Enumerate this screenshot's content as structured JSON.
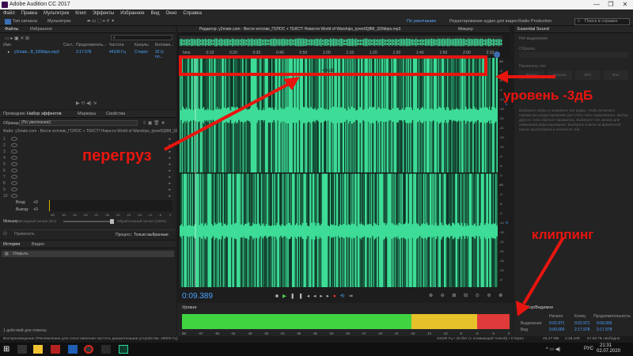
{
  "window": {
    "title": "Adobe Audition CC 2017",
    "controls": [
      "—",
      "❐",
      "✕"
    ]
  },
  "menu": [
    "Файл",
    "Правка",
    "Мультитрек",
    "Клип",
    "Эффекты",
    "Избранное",
    "Вид",
    "Окно",
    "Справка"
  ],
  "toolbar": {
    "waveform_label": "Тип сигнала",
    "multitrack_label": "Мультитрек",
    "workspace_default": "По умолчанию",
    "workspace_edit_audio": "Редактирование аудио для видео",
    "workspace_radio": "Radio Production",
    "search_placeholder": "Поиск в справке"
  },
  "files_panel": {
    "tabs": [
      "Файлы",
      "Избранное"
    ],
    "columns": [
      "Имя",
      "Сост...",
      "Продолжитель...",
      "Частота",
      "Каналы",
      "Битовая..."
    ],
    "file": {
      "name": "y2mate.com - Вест...ЛОС_+_ТЕКСТ!_Новост...B_320kbps.mp3",
      "name_short": "y2mate...B_320kbps.mp3",
      "duration": "2:17.978",
      "rate": "44100 Гц",
      "channels": "Стерео",
      "bits": "32 (с пл..."
    }
  },
  "effects_panel": {
    "tabs": [
      "Проводник",
      "Набор эффектов",
      "Маркеры",
      "Свойства"
    ],
    "presets_label": "Образцы:",
    "preset_value": "(По умолчанию)",
    "file_label": "Файл: y2mate.com - Вести хотспик_ГОЛОС + ТЕКСТ! Новости World of Warships_tyree0Q8M_320kbps.mp3",
    "slots": [
      "1",
      "2",
      "3",
      "4",
      "5",
      "6",
      "7",
      "8",
      "9",
      "10"
    ],
    "input_label": "Вход:",
    "output_label": "Выход:",
    "input_db": "+0",
    "output_db": "+0",
    "mix_label": "Микшир.:",
    "mix_dry": "Исходный сигнал (0%)",
    "mix_wet": "Обработанный сигнал (100%)",
    "apply_label": "Применить",
    "process_label": "Процесс:",
    "process_value": "Только выбранные",
    "meter_ticks": [
      "dB",
      "-60",
      "-54",
      "-48",
      "-42",
      "-36",
      "-30",
      "-24",
      "-18",
      "-12",
      "-6",
      "0"
    ]
  },
  "history_panel": {
    "tabs": [
      "История",
      "Видео"
    ],
    "item": "Открыть",
    "footer": "1 действий для отмены"
  },
  "editor": {
    "tab": "Редактор: y2mate.com - Вести хотспик_ГОЛОС + ТЕКСТ! Новости World of Warships_tyree0Q8M_320kbps.mp3",
    "mixer_tab": "Микшер",
    "ruler": [
      "hms",
      "0:10",
      "0:20",
      "0:30",
      "0:40",
      "0:50",
      "1:00",
      "1:10",
      "1:20",
      "1:30",
      "1:40",
      "1:50",
      "2:00",
      "2:10"
    ],
    "time": "0:09.389",
    "gain": "+0 dB",
    "db_scale": [
      "dB",
      "-3",
      "-6",
      "-9",
      "-12",
      "-15",
      "-21",
      "-21",
      "-15",
      "-12",
      "-9",
      "-6",
      "-3",
      "dB",
      "-3",
      "-6",
      "-9",
      "-12",
      "-15",
      "-21",
      "-21",
      "-15",
      "-12",
      "-9",
      "-6",
      "-3"
    ],
    "channels": [
      "L",
      "R"
    ]
  },
  "annotations": {
    "overload": "перегруз",
    "level": "уровень -3дБ",
    "clipping": "клиппинг"
  },
  "levels_panel": {
    "title": "Уровни",
    "ticks": [
      "dB",
      "-57",
      "-54",
      "-51",
      "-48",
      "-45",
      "-42",
      "-39",
      "-36",
      "-33",
      "-30",
      "-27",
      "-24",
      "-21",
      "-18",
      "-15",
      "-12",
      "-9",
      "-6",
      "-3",
      "0"
    ]
  },
  "selection_panel": {
    "title": "Выбор/Видимое",
    "headers": [
      "Начало",
      "Конец",
      "Продолжительность"
    ],
    "rows": [
      {
        "label": "Выделение",
        "start": "0:02.971",
        "end": "0:02.971",
        "dur": "0:00.000"
      },
      {
        "label": "Вид",
        "start": "0:00.000",
        "end": "2:17.978",
        "dur": "2:17.978"
      }
    ]
  },
  "essential_sound": {
    "title": "Essential Sound",
    "no_selection": "Нет выделения",
    "preset_label": "Образец",
    "assign_label": "Назначить тип",
    "types": [
      "Диалог",
      "Музыка",
      "SFX",
      "Фон"
    ],
    "help_text": "Выберите клипы и назначьте тип аудио, чтобы включить параметры редактирования для этого типа содержимого. Выбор другого типа сбросит параметры. Выберите тип заново для изменения редактирования. Выберите клипы на временной шкале мультитрека и назначьте тип."
  },
  "status": {
    "left": "Воспроизведение (Реклемление для сопоставления частоты дискретизации устройства: 48000 Гц)",
    "format": "44100 Гц • 32-бит (с плавающей точкой) • Стерео",
    "size": "46,47 МБ",
    "duration": "2:18.109",
    "free": "57,66 ГБ свободно"
  },
  "taskbar": {
    "time": "21:31",
    "date": "02.07.2020",
    "lang": "РУС"
  },
  "colors": {
    "waveform": "#3ddc97",
    "waveform_dark": "#0d2e22",
    "accent_blue": "#4aa3ff",
    "anno_red": "#e8150f",
    "meter_green": "#41d441",
    "meter_yellow": "#e6c12a",
    "meter_red": "#e03a3a"
  }
}
